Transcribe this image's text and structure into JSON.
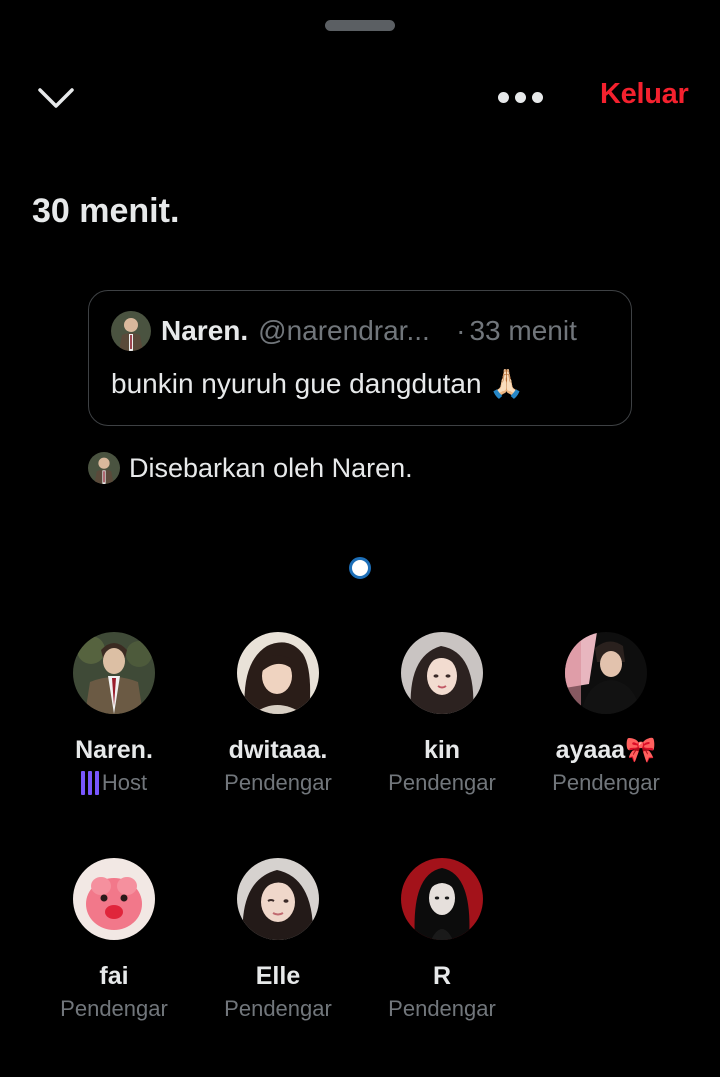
{
  "header": {
    "collapse_icon": "chevron-down-icon",
    "more_icon": "more-horizontal-icon",
    "leave_label": "Keluar",
    "leave_color": "#f4212e"
  },
  "space": {
    "duration": "30 menit."
  },
  "pinned_post": {
    "name": "Naren.",
    "handle": "@narendrar...",
    "separator": "·",
    "time": "33 menit",
    "text": "bunkin nyuruh gue dangdutan 🙏🏻"
  },
  "shared_by": {
    "text": "Disebarkan oleh Naren."
  },
  "participants": [
    {
      "name": "Naren.",
      "role": "Host",
      "role_icon": "speaker-bars-icon",
      "accent": "#7856ff"
    },
    {
      "name": "dwitaaa.",
      "role": "Pendengar"
    },
    {
      "name": "kin",
      "role": "Pendengar"
    },
    {
      "name": "ayaaa🎀",
      "role": "Pendengar"
    },
    {
      "name": "fai",
      "role": "Pendengar"
    },
    {
      "name": "Elle",
      "role": "Pendengar"
    },
    {
      "name": "R",
      "role": "Pendengar"
    }
  ]
}
